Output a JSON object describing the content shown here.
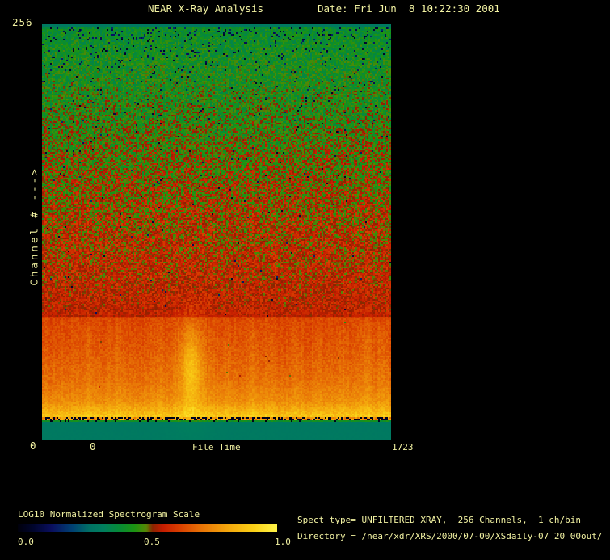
{
  "window": {
    "background": "#000000",
    "text_color": "#F2F2A2"
  },
  "header": {
    "title": "NEAR X-Ray Analysis",
    "date": "Date: Fri Jun  8 10:22:30 2001"
  },
  "plot": {
    "y_axis": {
      "label": "Channel # --->",
      "max_tick": "256",
      "min_tick": "0"
    },
    "x_axis": {
      "label": "File Time",
      "min_tick": "0",
      "max_tick": "1723"
    }
  },
  "legend": {
    "title": "LOG10 Normalized Spectrogram Scale",
    "tick_labels": [
      "0.0",
      "0.5",
      "1.0"
    ]
  },
  "info": {
    "spect_line": "Spect type= UNFILTERED XRAY,  256 Channels,  1 ch/bin",
    "directory_line": "Directory = /near/xdr/XRS/2000/07-00/XSdaily-07_20_00out/"
  },
  "chart_data": {
    "type": "heatmap",
    "title": "NEAR X-Ray Analysis",
    "xlabel": "File Time",
    "ylabel": "Channel # --->",
    "xlim": [
      0,
      1723
    ],
    "ylim": [
      0,
      256
    ],
    "grid": false,
    "colorbar": {
      "label": "LOG10 Normalized Spectrogram Scale",
      "ticks": [
        0.0,
        0.5,
        1.0
      ],
      "position": "bottom-left"
    },
    "description": "LOG10-normalized spectrogram: high channels (top) ~0.40-0.47 green with sparse blue/navy speckles, mid channels ~0.50-0.57 red mottle, low channels ~0.63-0.89 orange brightening to yellow near channel ~12, a dark speckled row, then bottom ~11 channels uniform teal ~0.31; transient vertical brightening near file time ~730 around channel ~45.",
    "render": {
      "cols": 216,
      "rows": 257,
      "seed": 1234,
      "value_profile": [
        [
          0.0,
          0.31,
          0.004,
          0.0
        ],
        [
          0.004,
          0.31,
          0.004,
          0.0
        ],
        [
          0.006,
          0.405,
          0.055,
          0.13
        ],
        [
          0.05,
          0.42,
          0.065,
          0.06
        ],
        [
          0.12,
          0.435,
          0.075,
          0.025
        ],
        [
          0.22,
          0.46,
          0.085,
          0.012
        ],
        [
          0.35,
          0.5,
          0.09,
          0.008
        ],
        [
          0.48,
          0.535,
          0.085,
          0.005
        ],
        [
          0.6,
          0.552,
          0.07,
          0.004
        ],
        [
          0.69,
          0.563,
          0.05,
          0.003
        ],
        [
          0.7,
          0.565,
          0.038,
          0.002
        ],
        [
          0.704,
          0.548,
          0.025,
          0.002
        ],
        [
          0.708,
          0.635,
          0.03,
          0.0
        ],
        [
          0.78,
          0.658,
          0.03,
          0.001
        ],
        [
          0.86,
          0.7,
          0.03,
          0.001
        ],
        [
          0.91,
          0.755,
          0.03,
          0.0
        ],
        [
          0.928,
          0.815,
          0.035,
          0.0
        ],
        [
          0.9465,
          0.885,
          0.04,
          0.0
        ],
        [
          0.9485,
          0.78,
          0.09,
          0.4
        ],
        [
          0.9555,
          0.78,
          0.09,
          0.4
        ],
        [
          0.9575,
          0.312,
          0.006,
          0.015
        ],
        [
          0.964,
          0.31,
          0.004,
          0.0
        ],
        [
          1.0,
          0.31,
          0.004,
          0.0
        ]
      ],
      "colormap_stops": [
        [
          0.0,
          0,
          0,
          12
        ],
        [
          0.06,
          0,
          5,
          45
        ],
        [
          0.13,
          10,
          15,
          95
        ],
        [
          0.21,
          0,
          65,
          115
        ],
        [
          0.28,
          0,
          114,
          100
        ],
        [
          0.33,
          0,
          126,
          94
        ],
        [
          0.39,
          6,
          138,
          55
        ],
        [
          0.45,
          28,
          148,
          18
        ],
        [
          0.495,
          85,
          135,
          5
        ],
        [
          0.52,
          138,
          35,
          0
        ],
        [
          0.56,
          196,
          28,
          0
        ],
        [
          0.63,
          218,
          66,
          0
        ],
        [
          0.71,
          232,
          116,
          6
        ],
        [
          0.81,
          243,
          166,
          12
        ],
        [
          0.91,
          250,
          208,
          22
        ],
        [
          1.0,
          255,
          243,
          72
        ]
      ],
      "streaks": [
        [
          0.135,
          2.5,
          0.02
        ],
        [
          0.215,
          3.0,
          0.026
        ],
        [
          0.33,
          2.0,
          0.014
        ],
        [
          0.425,
          3.5,
          0.04
        ],
        [
          0.53,
          2.5,
          0.02
        ],
        [
          0.6,
          2.5,
          0.026
        ],
        [
          0.647,
          2.2,
          0.02
        ],
        [
          0.727,
          2.2,
          0.02
        ],
        [
          0.79,
          2.0,
          0.014
        ],
        [
          0.855,
          2.8,
          0.022
        ],
        [
          0.925,
          3.5,
          0.032
        ],
        [
          0.972,
          2.5,
          0.028
        ]
      ],
      "blobs": [
        {
          "fx": 0.425,
          "fy": 0.822,
          "sx": 4.5,
          "sy": 13,
          "strength": 0.1
        },
        {
          "fx": 0.425,
          "fy": 0.82,
          "sx": 9.0,
          "sy": 26,
          "strength": 0.05
        }
      ],
      "column_jitter": 0.012
    }
  }
}
